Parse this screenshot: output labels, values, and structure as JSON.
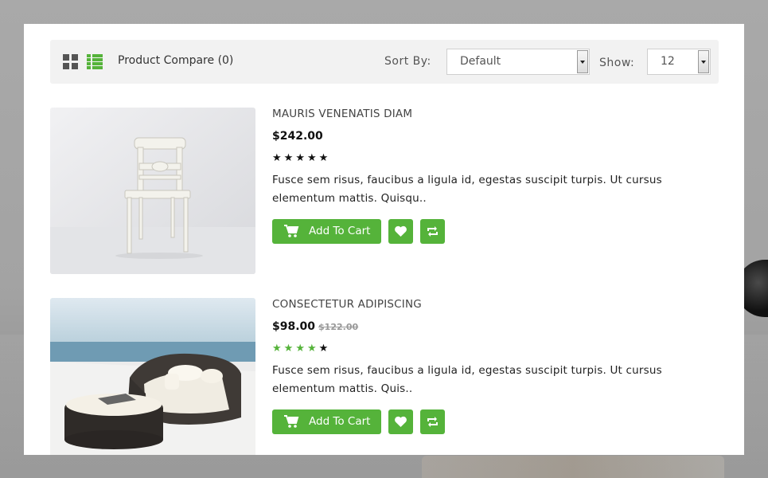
{
  "toolbar": {
    "grid_view": "grid-view-icon",
    "list_view": "list-view-icon",
    "compare_label": "Product Compare (0)",
    "sort_label": "Sort By:",
    "sort_value": "Default",
    "show_label": "Show:",
    "show_value": "12"
  },
  "colors": {
    "accent": "#55b33a",
    "toolbar_bg": "#f2f2f2",
    "text": "#222222"
  },
  "products": [
    {
      "name": "MAURIS VENENATIS DIAM",
      "price": "$242.00",
      "old_price": "",
      "rating": 5,
      "rating_filled_color": "#111111",
      "description": "Fusce sem risus, faucibus a ligula id, egestas suscipit turpis. Ut cursus elementum mattis. Quisqu..",
      "cart_label": "Add To Cart",
      "wishlist_icon": "heart-icon",
      "compare_icon": "compare-icon"
    },
    {
      "name": "CONSECTETUR ADIPISCING",
      "price": "$98.00",
      "old_price": "$122.00",
      "rating": 4,
      "rating_filled_color": "#55b33a",
      "description": "Fusce sem risus, faucibus a ligula id, egestas suscipit turpis. Ut cursus elementum mattis. Quis..",
      "cart_label": "Add To Cart",
      "wishlist_icon": "heart-icon",
      "compare_icon": "compare-icon"
    }
  ]
}
